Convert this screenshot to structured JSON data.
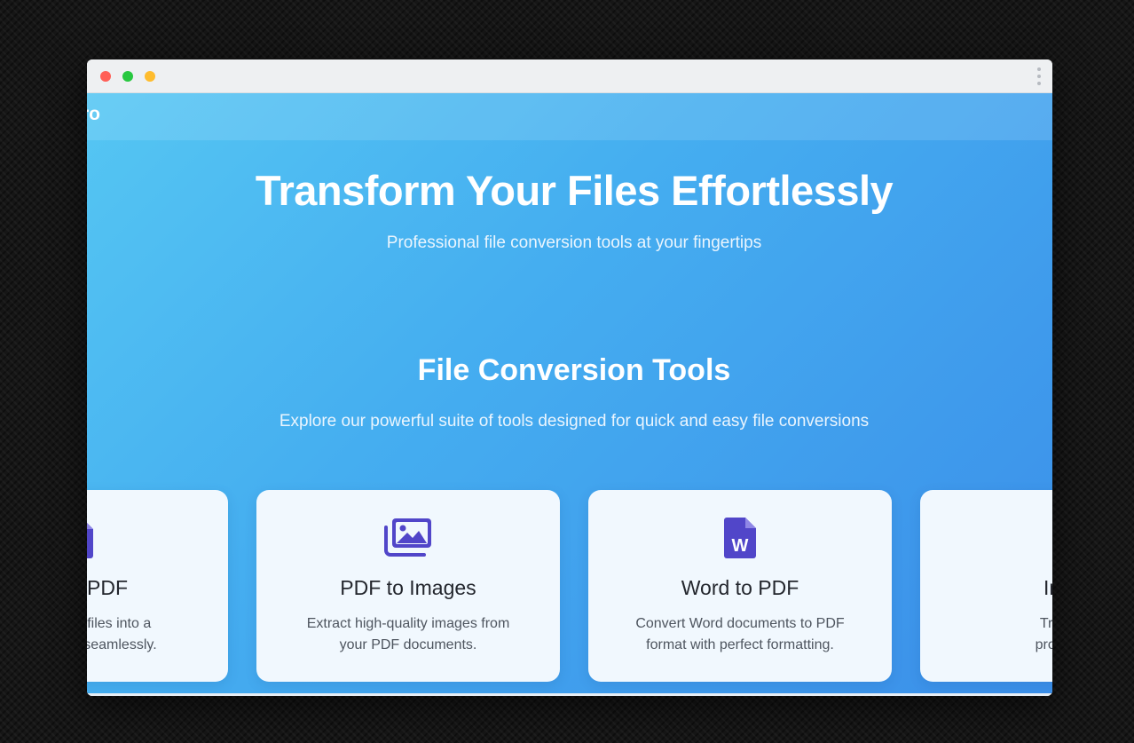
{
  "navbar": {
    "logo_text": "ro"
  },
  "hero": {
    "title": "Transform Your Files Effortlessly",
    "subtitle": "Professional file conversion tools at your fingertips"
  },
  "tools_section": {
    "title": "File Conversion Tools",
    "subtitle": "Explore our powerful suite of tools designed for quick and easy file conversions"
  },
  "cards": [
    {
      "icon": "file-icon",
      "title": "PDF",
      "desc_line1": "PDF files into a",
      "desc_line2": "t seamlessly."
    },
    {
      "icon": "images-icon",
      "title": "PDF to Images",
      "desc_line1": "Extract high-quality images from",
      "desc_line2": "your PDF documents."
    },
    {
      "icon": "word-file-icon",
      "title": "Word to PDF",
      "desc_line1": "Convert Word documents to PDF",
      "desc_line2": "format with perfect formatting."
    },
    {
      "icon": "image-icon",
      "title": "Image",
      "desc_line1": "Transform",
      "desc_line2": "professiona"
    }
  ],
  "colors": {
    "gradient_start": "#55c6f3",
    "gradient_end": "#3b8fe9",
    "icon_color": "#5146c9",
    "card_background": "#f1f8fe",
    "title_text": "#23262d"
  }
}
